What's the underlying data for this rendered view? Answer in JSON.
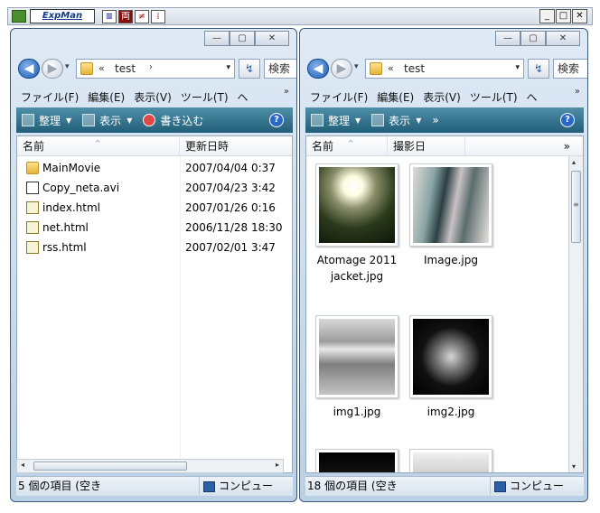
{
  "app": {
    "title": "ExpMan",
    "toolbar_icons": [
      "≡",
      "両",
      "≠",
      "⁞"
    ],
    "window_buttons": {
      "minimize": "_",
      "maximize": "□",
      "close": "✕"
    }
  },
  "left_pane": {
    "caption_buttons": {
      "minimize": "—",
      "maximize": "▢",
      "close": "✕"
    },
    "address": {
      "chevrons": "«",
      "path": "test",
      "sub_arrow": "›",
      "drop": "▾"
    },
    "nav": {
      "back": "◀",
      "forward": "▶",
      "history": "▾",
      "refresh": "↯"
    },
    "search_placeholder": "検索",
    "menu": [
      "ファイル(F)",
      "編集(E)",
      "表示(V)",
      "ツール(T)",
      "ヘ"
    ],
    "menu_more": "»",
    "commands": {
      "organize": "整理",
      "view": "表示",
      "burn": "書き込む",
      "dd": "▼",
      "help": "?"
    },
    "columns": {
      "name": "名前",
      "modified": "更新日時",
      "sort_arrow": "^"
    },
    "files": [
      {
        "name": "MainMovie",
        "date": "2007/04/04 0:37",
        "type": "folder"
      },
      {
        "name": "Copy_neta.avi",
        "date": "2007/04/23 3:42",
        "type": "video"
      },
      {
        "name": "index.html",
        "date": "2007/01/26 0:16",
        "type": "html"
      },
      {
        "name": "net.html",
        "date": "2006/11/28 18:30",
        "type": "html"
      },
      {
        "name": "rss.html",
        "date": "2007/02/01 3:47",
        "type": "html"
      }
    ],
    "scroll": {
      "left": "◂",
      "right": "▸"
    },
    "status": {
      "count": "5 個の項目 (空き",
      "location": "コンピュー"
    }
  },
  "right_pane": {
    "caption_buttons": {
      "minimize": "—",
      "maximize": "▢",
      "close": "✕"
    },
    "address": {
      "chevrons": "«",
      "path": "test",
      "drop": "▾"
    },
    "nav": {
      "back": "◀",
      "forward": "▶",
      "history": "▾",
      "refresh": "↯"
    },
    "search_placeholder": "検索",
    "menu": [
      "ファイル(F)",
      "編集(E)",
      "表示(V)",
      "ツール(T)",
      "ヘ"
    ],
    "menu_more": "»",
    "commands": {
      "organize": "整理",
      "view": "表示",
      "more": "»",
      "dd": "▼",
      "help": "?"
    },
    "columns": {
      "name": "名前",
      "date_taken": "撮影日",
      "more": "»",
      "sort_arrow": "^"
    },
    "thumbnails": [
      {
        "label": "Atomage 2011 jacket.jpg"
      },
      {
        "label": "Image.jpg"
      },
      {
        "label": "img1.jpg"
      },
      {
        "label": "img2.jpg"
      },
      {
        "label": ""
      },
      {
        "label": ""
      }
    ],
    "scroll": {
      "up": "▴",
      "down": "▾",
      "grip": "≡"
    },
    "status": {
      "count": "18 個の項目 (空き",
      "location": "コンピュー"
    }
  },
  "colors": {
    "command_bar": "#215e79",
    "frame": "#b9d0e6",
    "back_button": "#1c5bb8"
  }
}
